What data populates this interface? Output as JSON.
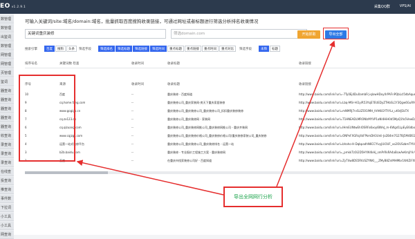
{
  "topbar": {
    "brand": "EO",
    "version": "v1.2.9.1",
    "links": [
      "采集QQ群",
      "VPS/AI"
    ]
  },
  "sidebar": {
    "items": [
      "数管理",
      "数管理",
      "出鉴词",
      "数管理",
      "网管理",
      "网管理",
      "页管理",
      "鉴词",
      "器查询",
      "器查询",
      "器查询",
      "器查询",
      "器查询",
      "收查询",
      "录查询",
      "录查询",
      "录查询",
      "在线查询",
      "投查询",
      "推查询",
      "事件数",
      "下拉词",
      "小工具",
      "小工具",
      "网查询"
    ]
  },
  "main": {
    "description": "可输入关键词/site:域名/domain:域名，批量抓取百度搜狗收录链接，可通过网址或者标题进行筛选分析排名收录情况",
    "keyword_input": "关键词重庆装修",
    "domain_input": {
      "placeholder": "筛选domain.com"
    },
    "buttons": {
      "start": "开始抓取",
      "export": "导出全部"
    }
  },
  "filters": {
    "engine_label": "搜索引擎",
    "engines": [
      "百度",
      "搜狗",
      "头条"
    ],
    "fields_label": "筛选字段",
    "field_buttons": [
      "筛选排名",
      "筛选标题",
      "筛选链接",
      "筛选时间",
      "重点标题",
      "重点链接",
      "重点时间",
      "重点对比"
    ],
    "mode_label": "筛选字段",
    "modes": [
      "未筛",
      "标题"
    ]
  },
  "table": {
    "outer_headers": [
      "排序号名",
      "关键词数 检查",
      "收录时间",
      "收录标题",
      "收录链接"
    ],
    "inner_headers": [
      "序号",
      "来源",
      "收录时间",
      "收录标题",
      "收录链接"
    ],
    "rows": [
      {
        "no": "10",
        "source": "百度",
        "time": "--",
        "title": "重庆装修 - 百度知道",
        "link": "http://www.baidu.com/link?url=-7Ty0Ej4Du0ambFrj-qlowHDxyXrPAFnPQbLcI5dbAqueTHQ2"
      },
      {
        "no": "9",
        "source": "cq.home.fang.com",
        "time": "--",
        "title": "重庆装修公司_重庆家装网-房天下重庆家居装修",
        "link": "http://www.baidu.com/link?url=Lbq-M6r-Hi1yiR53YqE7EUEDyZTHbSL1Y3Qgw6GuR9hEHdr7m"
      },
      {
        "no": "8",
        "source": "www.gogigo.cn",
        "time": "--",
        "title": "重庆装修公司_重庆装修公司_重庆装修公司_扣扣重庆装修装修",
        "link": "http://www.baidu.com/link?url=mNMRJ7rvSLIZOl1IMH_tVHKiGYTtYLz_ut0dJ1bTX"
      },
      {
        "no": "7",
        "source": "cq.zx123.cn",
        "time": "--",
        "title": "重庆装修公司_重庆装修网 - 家装网",
        "link": "http://www.baidu.com/link?url=T1HNEADLMRONIzMYVP1aNI4HiH0d5MpQ1fo5VewDzPO"
      },
      {
        "no": "6",
        "source": "cq.qizuang.com",
        "time": "--",
        "title": "重庆装修公司_重庆装修网推公司_重庆装修网推公司 - 重庆齐装网",
        "link": "http://www.baidu.com/link?url=IHmEUNtwEhlOSRFa6xoyIBWvJ_m-6Wgd1LpEyE6dbxSnzVa"
      },
      {
        "no": "5",
        "source": "www.cqjzgs.com",
        "time": "--",
        "title": "重庆装修公司_重庆装修价格公司_重庆装修价格公司(重庆装修家装公司_重庆装修",
        "link": "http://www.baidu.com/link?url=ONPnFXGRsj4kFPkmDH3Unli-Jo2B4m7G27Bj5M4BS1N"
      },
      {
        "no": "4",
        "source": "运营一站式装修平台",
        "time": "--",
        "title": "重庆装修公司_重庆装修公司_重庆装修排名 - 运营一站",
        "link": "http://www.baidu.com/link?url=bhaho-H-DqbpadhN6CCYlvyjUiOUF_vo2OUSzbmTYIVBnNdFUG"
      },
      {
        "no": "3",
        "source": "b2b.baidu.com",
        "time": "--",
        "title": "重庆装修 - 专业报价工程施工方案 - 重庆装修网",
        "link": "http://www.baidu.com/link?url=_pmkkTzOi2D5HYW4kHj_smPrRkRA4aBcwAeKmJiYk-Yr_"
      },
      {
        "no": "1",
        "source": "百度",
        "time": "--",
        "title": "在重庆市找家装修公司好 - 百度知道",
        "link": "http://www.baidu.com/link?url=ZyT4w8DS5RVzSZYNKl___ZMyB8ZnIMHMbr1W4ZiFXh5VnHB4HPNh"
      }
    ]
  },
  "annotation": {
    "label": "导出全网网行分析"
  },
  "colors": {
    "topbar": "#2c3a4d",
    "accent_red": "#e52d2d",
    "accent_blue": "#3366ee",
    "callout_green": "#1aa34a",
    "export_btn": "#2d79e6",
    "start_btn": "#f0a531"
  }
}
